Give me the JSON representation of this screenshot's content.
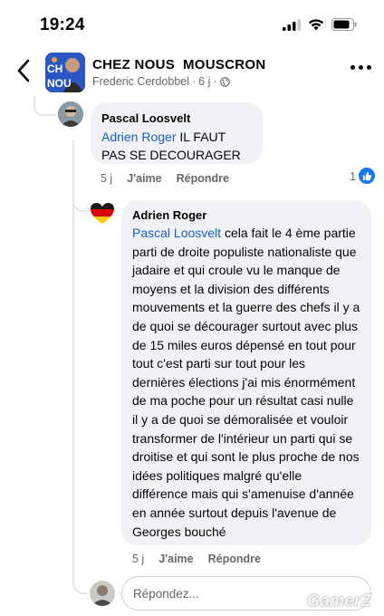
{
  "status_bar": {
    "time": "19:24"
  },
  "header": {
    "group_name": "CHEZ NOUS  MOUSCRON",
    "author": "Frederic Cerdobbel",
    "age": "6 j",
    "separator": "·",
    "avatar_text": "CH\nNOU"
  },
  "comments": [
    {
      "author": "Pascal Loosvelt",
      "mention": "Adrien Roger",
      "text": " IL FAUT PAS SE DECOURAGER",
      "age": "5 j",
      "like_label": "J'aime",
      "reply_label": "Répondre",
      "reaction_count": "1"
    },
    {
      "author": "Adrien Roger",
      "mention": "Pascal Loosvelt",
      "text": " cela fait le 4 ème partie parti de droite populiste nationaliste que jadaire et qui croule vu le manque de moyens et la division des différents mouvements et la guerre des chefs il y a de quoi se décourager surtout avec plus de 15 miles euros dépensé en tout pour tout c'est parti sur tout pour les dernières élections j'ai mis énormément de ma poche pour un résultat casi nulle il y a de quoi se démoralisée et vouloir transformer de l'intérieur un parti qui se droitise et qui sont le plus proche de nos idées politiques malgré qu'elle différence mais qui s'amenuise d'année en année surtout depuis l'avenue de Georges bouché",
      "age": "5 j",
      "like_label": "J'aime",
      "reply_label": "Répondre"
    }
  ],
  "reply_input": {
    "placeholder": "Répondez..."
  },
  "watermark": "GamerZ",
  "colors": {
    "mention": "#1d5fbf",
    "bubble": "#f0f2f5",
    "like": "#1877f2",
    "secondary_text": "#65676b"
  },
  "icons": [
    "signal-icon",
    "wifi-icon",
    "battery-icon",
    "back-arrow-icon",
    "globe-icon",
    "more-icon",
    "like-icon",
    "germany-heart-icon"
  ]
}
